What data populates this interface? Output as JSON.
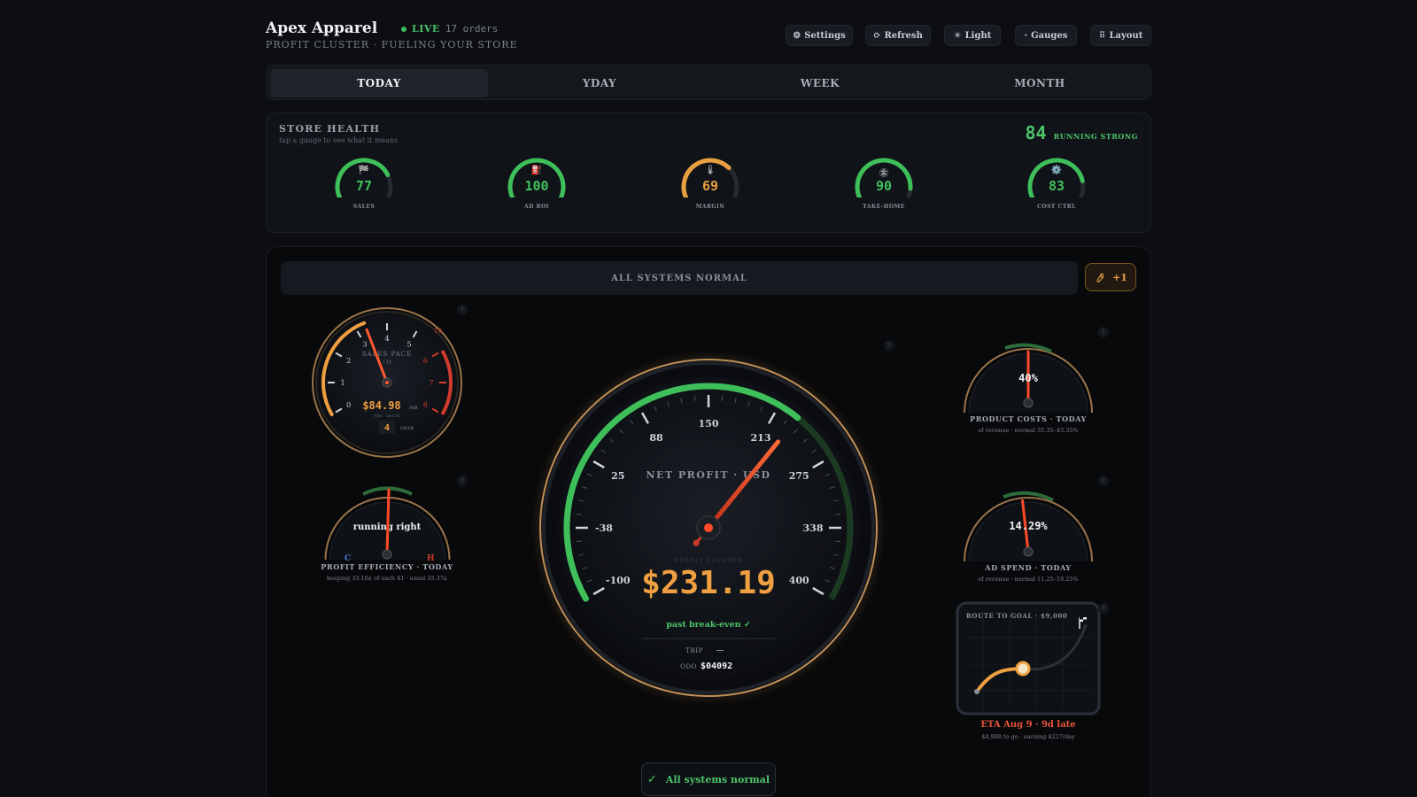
{
  "header": {
    "title": "Apex Apparel",
    "subtitle": "PROFIT CLUSTER · FUELING YOUR STORE",
    "live_label": "LIVE",
    "orders": "17 orders"
  },
  "toolbar": [
    {
      "icon": "gear-icon",
      "glyph": "⚙",
      "label": "Settings"
    },
    {
      "icon": "refresh-icon",
      "glyph": "⟳",
      "label": "Refresh"
    },
    {
      "icon": "sun-icon",
      "glyph": "☀",
      "label": "Light"
    },
    {
      "icon": "dot-icon",
      "glyph": "·",
      "label": "Gauges"
    },
    {
      "icon": "grid-icon",
      "glyph": "⠿",
      "label": "Layout"
    }
  ],
  "tabs": [
    "TODAY",
    "YDAY",
    "WEEK",
    "MONTH"
  ],
  "active_tab": "TODAY",
  "health": {
    "title": "STORE HEALTH",
    "subtitle": "tap a gauge to see what it means",
    "score": "84",
    "score_label": "RUNNING STRONG",
    "gauges": [
      {
        "icon": "🏁",
        "value": 77,
        "label": "SALES",
        "color": "#3fbf5a"
      },
      {
        "icon": "⛽",
        "value": 100,
        "label": "AD ROI",
        "color": "#3fbf5a"
      },
      {
        "icon": "🌡",
        "value": 69,
        "label": "MARGIN",
        "color": "#e8a040"
      },
      {
        "icon": "㊎",
        "value": 90,
        "label": "TAKE-HOME",
        "color": "#3fbf5a"
      },
      {
        "icon": "⚙️",
        "value": 83,
        "label": "COST CTRL",
        "color": "#3fbf5a"
      }
    ]
  },
  "banner": "ALL SYSTEMS NORMAL",
  "alert_count": "+1",
  "tach": {
    "label": "SALES PACE",
    "unit": "/ H",
    "ticks": [
      "0",
      "1",
      "2",
      "3",
      "4",
      "5",
      "6",
      "7",
      "8"
    ],
    "redline": "10",
    "value": "$84.98",
    "value_unit": "/HR",
    "sub": "9/hr · last 3h",
    "gear": "4",
    "gear_label": "GEAR",
    "needle": 3.3
  },
  "temp": {
    "status": "running right",
    "cold": "C",
    "hot": "H",
    "title": "PROFIT EFFICIENCY · TODAY",
    "sub": "keeping 33.16¢ of each $1 · usual 33.37¢"
  },
  "speedo": {
    "label": "NET PROFIT · USD",
    "min": -100,
    "max": 400,
    "ticks": [
      "-100",
      "-38",
      "25",
      "88",
      "150",
      "213",
      "275",
      "338",
      "400"
    ],
    "value": 231.19,
    "display": "$231.19",
    "small_label": "PROFIT CLUSTER",
    "status": "past break-even ✓",
    "trip_label": "TRIP",
    "trip": "—",
    "odo_label": "ODO",
    "odo": "$04092"
  },
  "product_costs": {
    "value": "40%",
    "title": "PRODUCT COSTS · TODAY",
    "sub": "of revenue · normal 35.35–43.35%",
    "pct": 40,
    "min": 20,
    "max": 60
  },
  "ad_spend": {
    "value": "14.29%",
    "title": "AD SPEND · TODAY",
    "sub": "of revenue · normal 11.25–19.25%",
    "pct": 14.29,
    "min": 5,
    "max": 25
  },
  "route": {
    "title": "ROUTE TO GOAL · $9,000",
    "eta": "ETA Aug 9 · 9d late",
    "sub": "$4,908 to go · earning $227/day"
  },
  "footer_status": "All systems normal"
}
